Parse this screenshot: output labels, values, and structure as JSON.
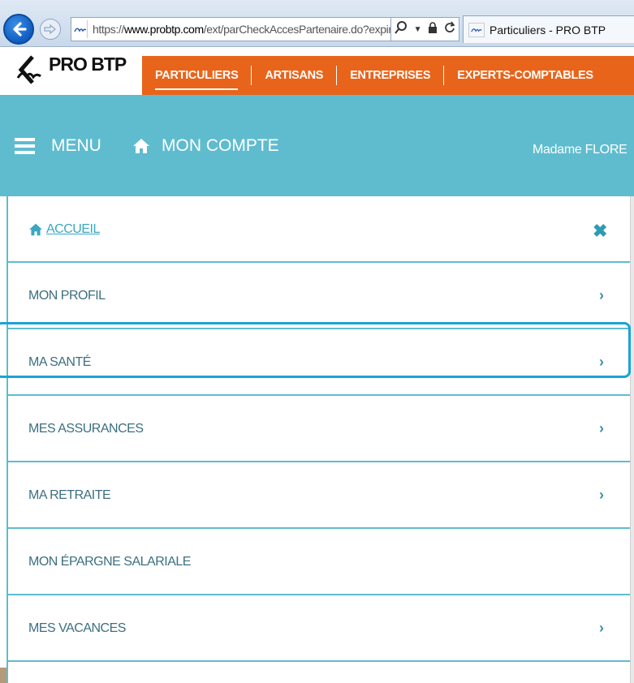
{
  "browser": {
    "url_prefix": "https://",
    "url_domain": "www.probtp.com",
    "url_path": "/ext/parCheckAccesPartenaire.do?expired=tri",
    "tab_title": "Particuliers - PRO BTP"
  },
  "site": {
    "logo_text": "PRO BTP",
    "nav": [
      "PARTICULIERS",
      "ARTISANS",
      "ENTREPRISES",
      "EXPERTS-COMPTABLES"
    ],
    "active_nav": "PARTICULIERS"
  },
  "bar": {
    "menu_label": "MENU",
    "account_label": "MON COMPTE",
    "user_name": "Madame FLORE"
  },
  "menu": {
    "home_label": "ACCUEIL",
    "items": [
      {
        "label": "MON PROFIL",
        "chevron": "›"
      },
      {
        "label": "MA SANTÉ",
        "chevron": "›"
      },
      {
        "label": "MES ASSURANCES",
        "chevron": "›"
      },
      {
        "label": "MA RETRAITE",
        "chevron": "›"
      },
      {
        "label": "MON ÉPARGNE SALARIALE",
        "chevron": ""
      },
      {
        "label": "MES VACANCES",
        "chevron": "›"
      }
    ],
    "close_glyph": "✖"
  },
  "colors": {
    "orange": "#e8641b",
    "teal": "#5fbccf",
    "highlight": "#1aa3d6"
  }
}
